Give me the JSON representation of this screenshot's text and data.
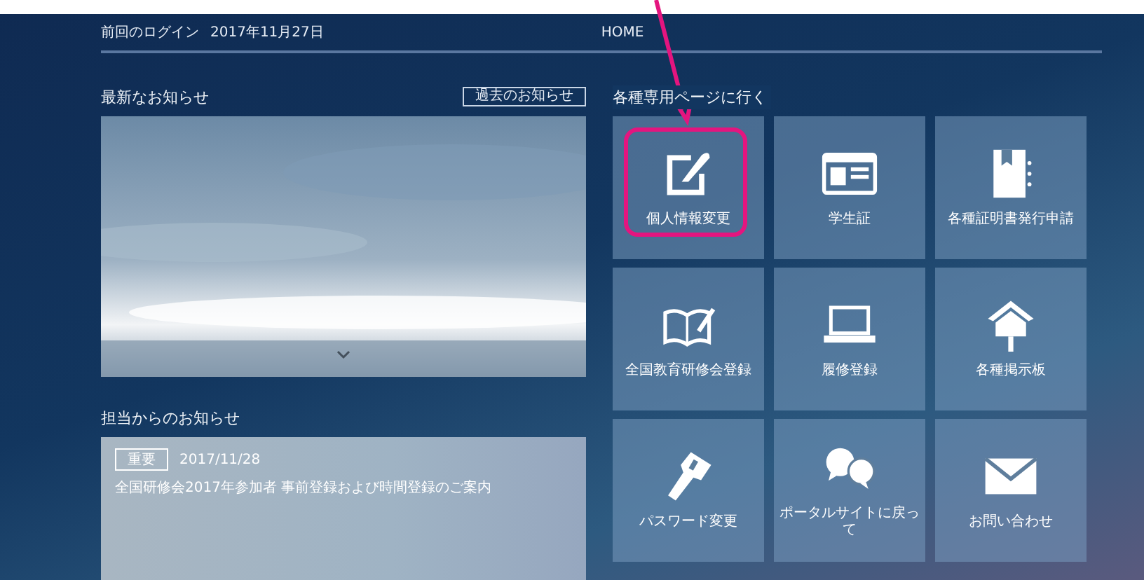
{
  "header": {
    "last_login_label": "前回のログイン",
    "last_login_date": "2017年11月27日",
    "home_link": "HOME"
  },
  "latest_news": {
    "title": "最新なお知らせ",
    "past_button": "過去のお知らせ"
  },
  "staff_news": {
    "title": "担当からのお知らせ",
    "items": [
      {
        "badge": "重要",
        "date": "2017/11/28",
        "message": "全国研修会2017年参加者 事前登録および時間登録のご案内"
      }
    ]
  },
  "pages": {
    "title": "各種専用ページに行く",
    "tiles": [
      {
        "kind": "edit",
        "label": "個人情報変更",
        "highlighted": true
      },
      {
        "kind": "card",
        "label": "学生証",
        "highlighted": false
      },
      {
        "kind": "binder",
        "label": "各種証明書発行申請",
        "highlighted": false
      },
      {
        "kind": "book",
        "label": "全国教育研修会登録",
        "highlighted": false
      },
      {
        "kind": "laptop",
        "label": "履修登録",
        "highlighted": false
      },
      {
        "kind": "house",
        "label": "各種掲示板",
        "highlighted": false
      },
      {
        "kind": "key",
        "label": "パスワード変更",
        "highlighted": false
      },
      {
        "kind": "qa",
        "label": "ポータルサイトに戻って",
        "highlighted": false
      },
      {
        "kind": "mail",
        "label": "お問い合わせ",
        "highlighted": false
      }
    ]
  }
}
